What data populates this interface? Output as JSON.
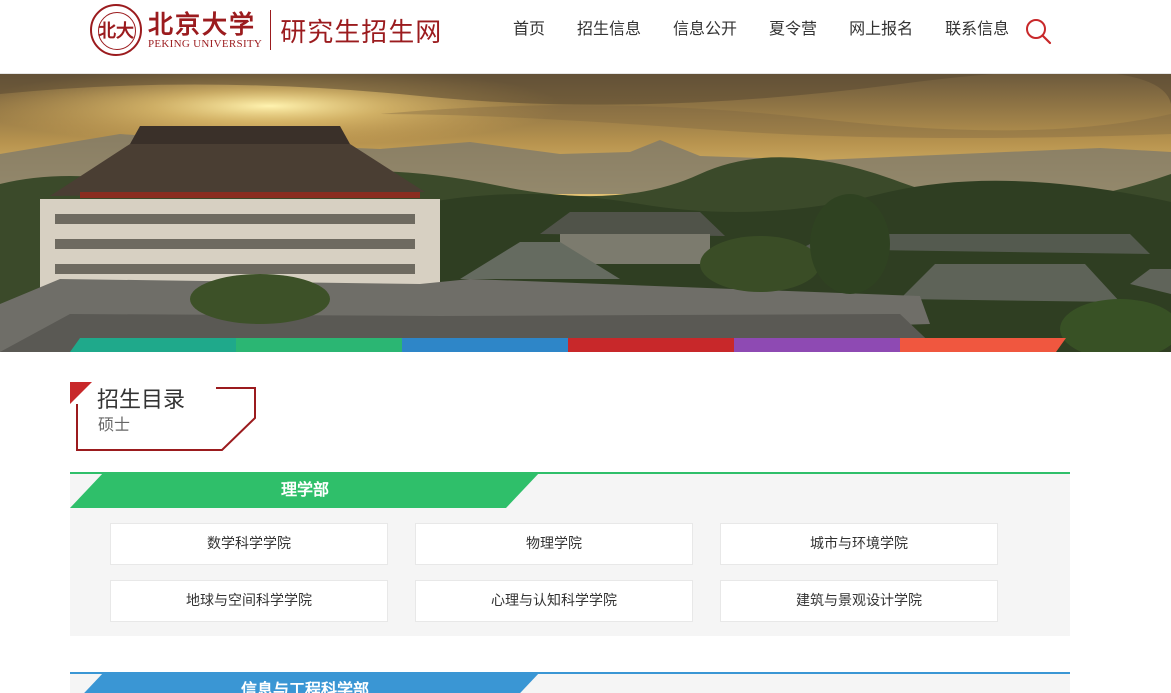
{
  "header": {
    "university_cn": "北京大学",
    "university_en": "PEKING UNIVERSITY",
    "seal_char": "北大",
    "site_name": "研究生招生网",
    "nav": [
      "首页",
      "招生信息",
      "信息公开",
      "夏令营",
      "网上报名",
      "联系信息"
    ],
    "search_icon": "search-icon"
  },
  "banner": {
    "stripe_colors": [
      "#1fa98b",
      "#2bb673",
      "#2e86c8",
      "#c8282a",
      "#8e4ab3",
      "#f0573f"
    ]
  },
  "catalog": {
    "title": "招生目录",
    "subtitle": "硕士"
  },
  "departments": [
    {
      "name": "理学部",
      "color": "#2fbf6a",
      "schools": [
        "数学科学学院",
        "物理学院",
        "城市与环境学院",
        "地球与空间科学学院",
        "心理与认知科学学院",
        "建筑与景观设计学院"
      ]
    },
    {
      "name": "信息与工程科学部",
      "color": "#3a96d4",
      "schools": []
    }
  ],
  "colors": {
    "brand": "#9b1b1e",
    "accent_red": "#c8282a"
  }
}
